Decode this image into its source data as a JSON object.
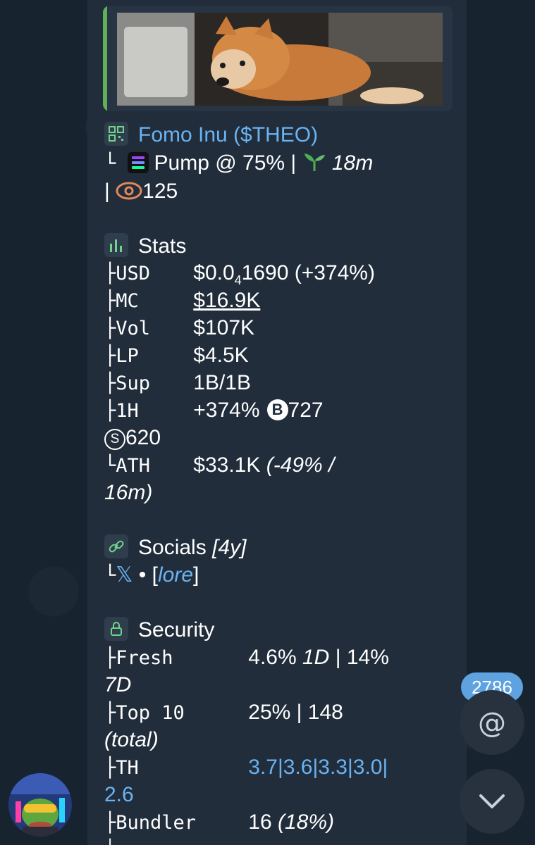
{
  "token": {
    "name": "Fomo Inu ($THEO)",
    "platform": "Pump @ 75% |",
    "age": "18m",
    "views_prefix": "|",
    "views": "125"
  },
  "stats": {
    "title": "Stats",
    "rows": [
      {
        "label": "USD",
        "value_a": "$0.0",
        "value_sub": "4",
        "value_b": "1690 (+374%)"
      },
      {
        "label": "MC",
        "value": "$16.9K"
      },
      {
        "label": "Vol",
        "value": "$107K"
      },
      {
        "label": "LP",
        "value": "$4.5K"
      },
      {
        "label": "Sup",
        "value": "1B/1B"
      },
      {
        "label": "1H",
        "value": "+374%",
        "buys": "727",
        "sells": "620"
      },
      {
        "label": "ATH",
        "value": "$33.1K",
        "value_ital_a": "(-49% /",
        "value_ital_b": "16m)"
      }
    ]
  },
  "socials": {
    "title": "Socials",
    "age": "[4y]",
    "x": "𝕏",
    "sep": "•",
    "lore_open": "[",
    "lore": "lore",
    "lore_close": "]"
  },
  "security": {
    "title": "Security",
    "fresh_label": "Fresh",
    "fresh_a": "4.6%",
    "fresh_b": "1D",
    "fresh_c": "| 14%",
    "fresh_d": "7D",
    "top10_label": "Top 10",
    "top10_value": "25% | 148",
    "top10_sub": "(total)",
    "th_label": "TH",
    "th_value": "3.7|3.6|3.3|3.0|",
    "th_value2": "2.6",
    "bundler_label": "Bundler",
    "bundler_value": "16",
    "bundler_pct": "(18%)"
  },
  "ui": {
    "unread_count": "2786",
    "mention_symbol": "@",
    "buy_badge": "B",
    "sell_badge": "S"
  },
  "colors": {
    "background": "#182330",
    "bubble": "#212d3b",
    "link": "#6ab3f3",
    "accent_green": "#5fb157",
    "counter": "#5ea2e0"
  }
}
